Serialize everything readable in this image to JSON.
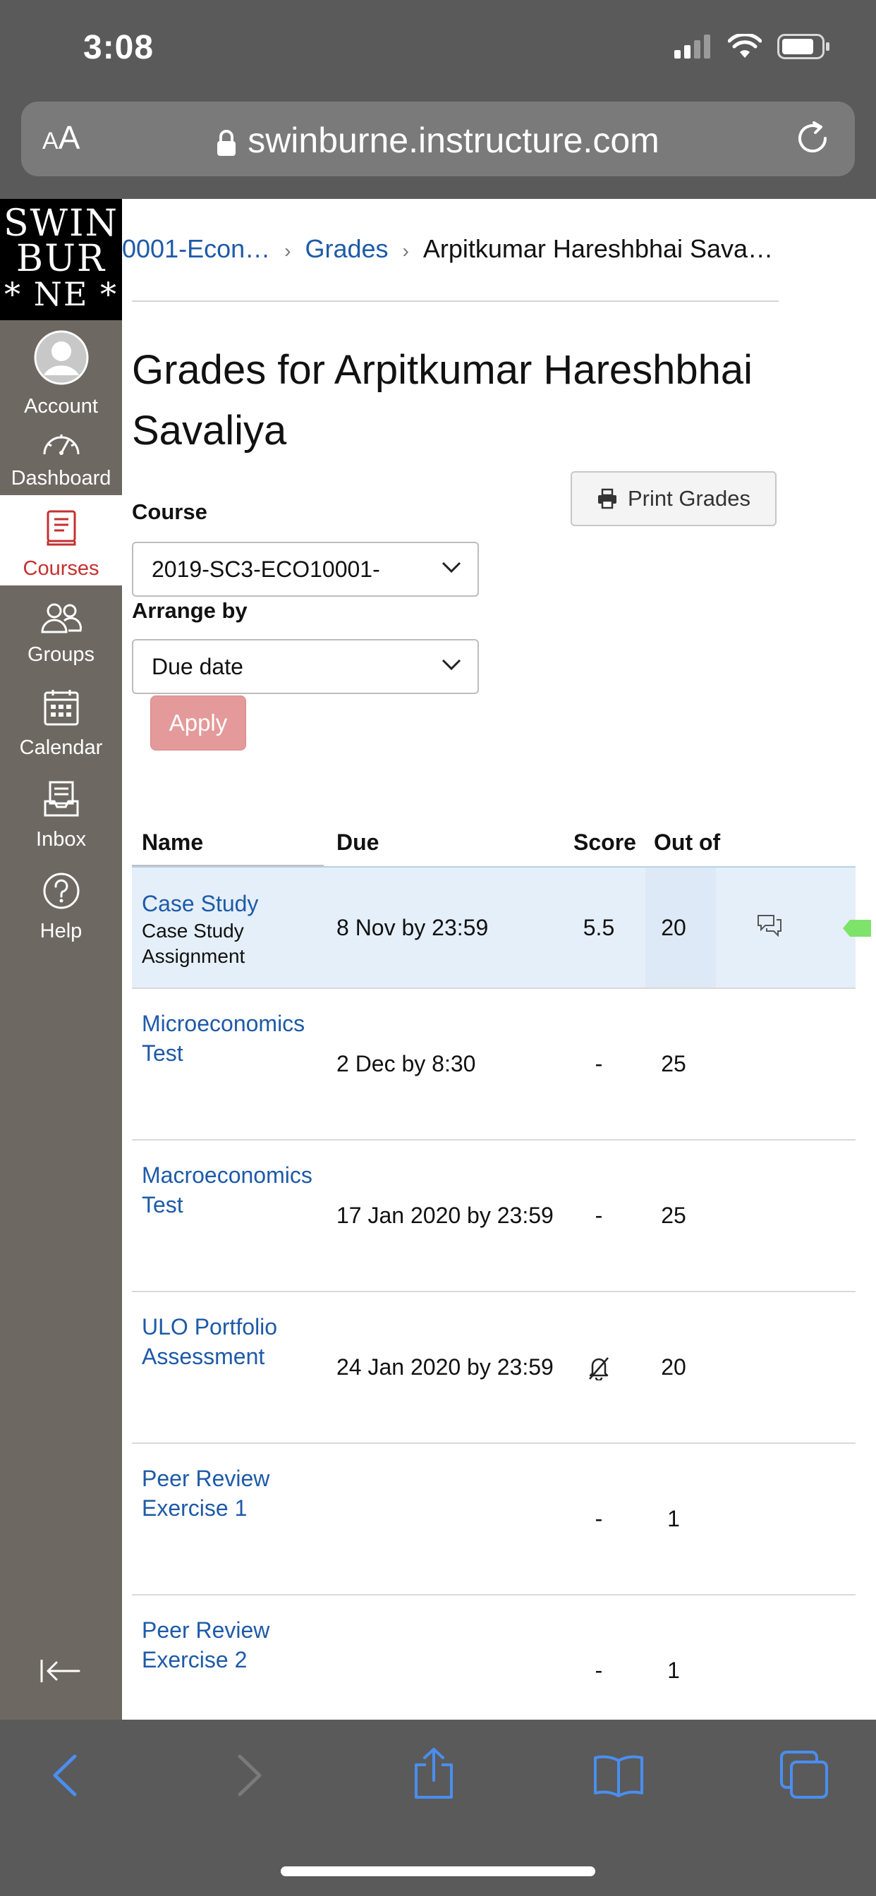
{
  "status_bar": {
    "time": "3:08"
  },
  "browser": {
    "aa_small": "A",
    "aa_large": "A",
    "url": "swinburne.instructure.com"
  },
  "logo": {
    "line1": "SWIN",
    "line2": "BUR",
    "line3": "* NE *"
  },
  "sidebar": {
    "items": [
      {
        "label": "Account",
        "icon": "account-icon"
      },
      {
        "label": "Dashboard",
        "icon": "dashboard-icon"
      },
      {
        "label": "Courses",
        "icon": "courses-icon"
      },
      {
        "label": "Groups",
        "icon": "groups-icon"
      },
      {
        "label": "Calendar",
        "icon": "calendar-icon"
      },
      {
        "label": "Inbox",
        "icon": "inbox-icon"
      },
      {
        "label": "Help",
        "icon": "help-icon"
      }
    ]
  },
  "breadcrumb": {
    "course": "0001-Econ…",
    "grades": "Grades",
    "student": "Arpitkumar Hareshbhai Sava…"
  },
  "page": {
    "title": "Grades for Arpitkumar Hareshbhai Savaliya",
    "print_label": "Print Grades",
    "course_label": "Course",
    "course_value": "2019-SC3-ECO10001-",
    "arrange_label": "Arrange by",
    "arrange_value": "Due date",
    "apply_label": "Apply"
  },
  "table": {
    "headers": {
      "name": "Name",
      "due": "Due",
      "score": "Score",
      "out_of": "Out of"
    },
    "rows": [
      {
        "name": "Case Study",
        "sub": "Case Study Assignment",
        "due": "8 Nov by 23:59",
        "score": "5.5",
        "out_of": "20"
      },
      {
        "name": "Microeconomics Test",
        "sub": "",
        "due": "2 Dec by 8:30",
        "score": "-",
        "out_of": "25"
      },
      {
        "name": "Macroeconomics Test",
        "sub": "",
        "due": "17 Jan 2020 by 23:59",
        "score": "-",
        "out_of": "25"
      },
      {
        "name": "ULO Portfolio Assessment",
        "sub": "",
        "due": "24 Jan 2020 by 23:59",
        "score": "",
        "out_of": "20"
      },
      {
        "name": "Peer Review Exercise 1",
        "sub": "",
        "due": "",
        "score": "-",
        "out_of": "1"
      },
      {
        "name": "Peer Review Exercise 2",
        "sub": "",
        "due": "",
        "score": "-",
        "out_of": "1"
      }
    ]
  },
  "colors": {
    "sidebar_bg": "#6e6862",
    "active_accent": "#c53030",
    "link": "#1e5aa8",
    "apply_bg": "#e49a9a",
    "highlight_row": "#e5eff9",
    "chrome_bg": "#5a5a5a",
    "toolbar_icon": "#4a8ef0"
  }
}
